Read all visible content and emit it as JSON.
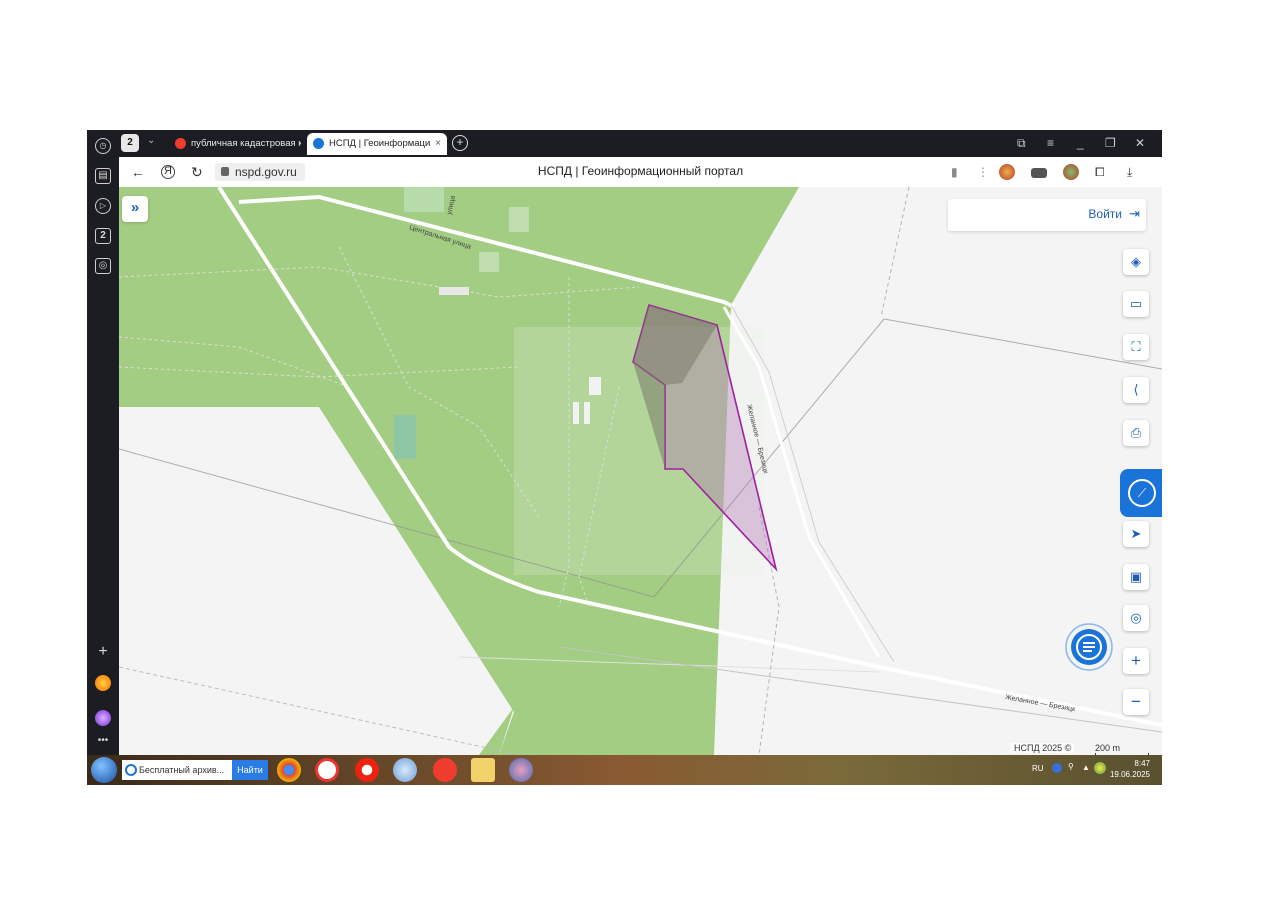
{
  "browser": {
    "sidebar_badge": "2",
    "tabs": [
      {
        "label": "публичная кадастровая к",
        "icon": "yandex-icon",
        "active": false
      },
      {
        "label": "НСПД | Геоинформаци",
        "icon": "nspd-icon",
        "active": true
      }
    ],
    "tab_count": "2",
    "new_tab_symbol": "+",
    "tab_close_symbol": "×",
    "url": "nspd.gov.ru",
    "page_title": "НСПД | Геоинформационный портал"
  },
  "map": {
    "login_label": "Войти",
    "street_labels": [
      "Центральная улица",
      "улица",
      "Желанное — Брезицк",
      "Желанное — Брезицк"
    ],
    "copyright": "НСПД 2025 ©",
    "scale_label": "200 m",
    "expand_symbol": "»",
    "zoom_in_symbol": "+",
    "zoom_out_symbol": "−",
    "parcel_color": "#a020a0",
    "forest_color": "#a3cd82"
  },
  "taskbar": {
    "search_text": "Бесплатный архив...",
    "search_button": "Найти",
    "lang": "RU",
    "time": "8:47",
    "date": "19.06.2025"
  }
}
